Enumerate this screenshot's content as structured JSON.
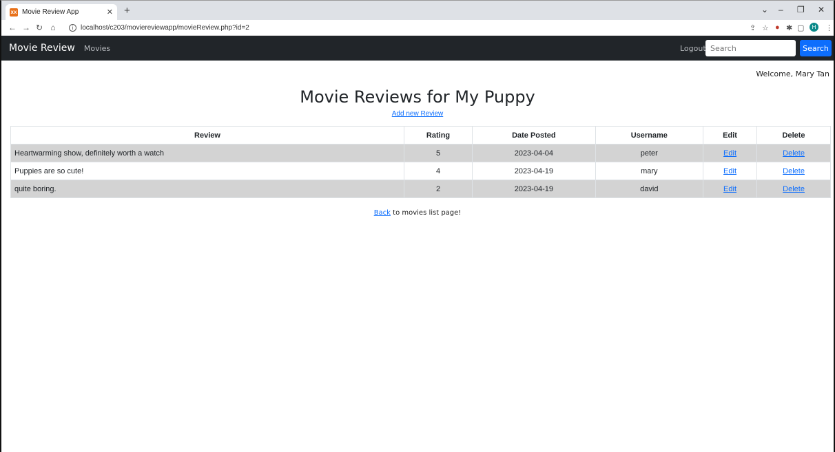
{
  "browser": {
    "tab_title": "Movie Review App",
    "favicon_text": "xx",
    "url": "localhost/c203/moviereviewapp/movieReview.php?id=2",
    "profile_initial": "H"
  },
  "navbar": {
    "brand": "Movie Review",
    "movies_link": "Movies",
    "logout_link": "Logout",
    "search_placeholder": "Search",
    "search_button": "Search"
  },
  "welcome": "Welcome, Mary Tan",
  "page": {
    "title": "Movie Reviews for My Puppy",
    "add_link": "Add new Review"
  },
  "table": {
    "headers": [
      "Review",
      "Rating",
      "Date Posted",
      "Username",
      "Edit",
      "Delete"
    ],
    "rows": [
      {
        "review": "Heartwarming show, definitely worth a watch",
        "rating": "5",
        "date": "2023-04-04",
        "username": "peter",
        "edit": "Edit",
        "delete": "Delete"
      },
      {
        "review": "Puppies are so cute!",
        "rating": "4",
        "date": "2023-04-19",
        "username": "mary",
        "edit": "Edit",
        "delete": "Delete"
      },
      {
        "review": "quite boring.",
        "rating": "2",
        "date": "2023-04-19",
        "username": "david",
        "edit": "Edit",
        "delete": "Delete"
      }
    ]
  },
  "back": {
    "link": "Back",
    "text": " to movies list page!"
  },
  "colors": {
    "navbar_bg": "#212529",
    "accent": "#0d6efd",
    "stripe": "#d3d3d3"
  }
}
